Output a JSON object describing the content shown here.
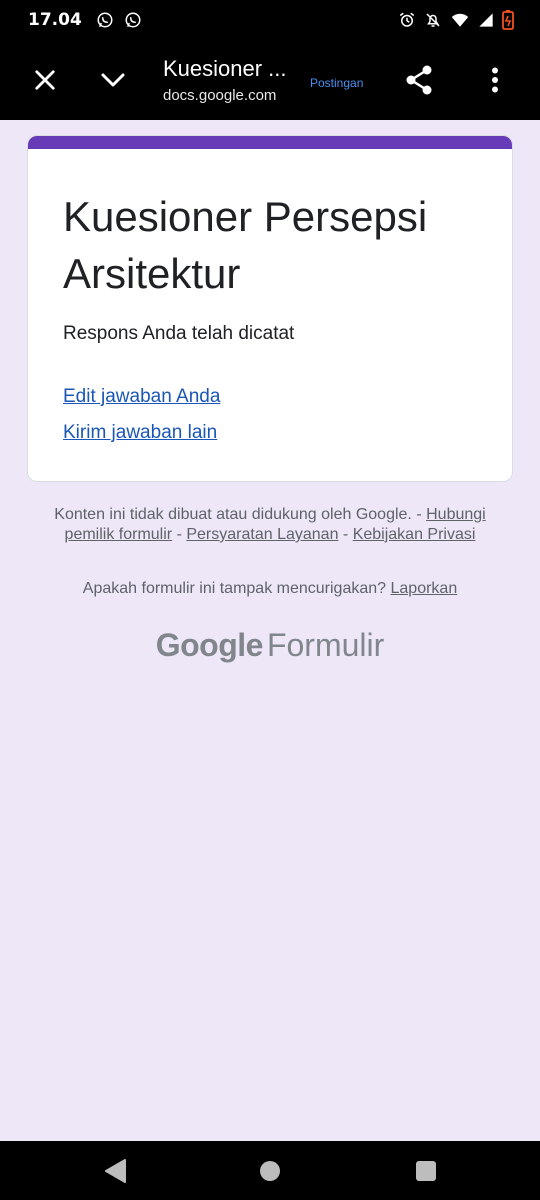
{
  "status_bar": {
    "time": "17.04",
    "icons": [
      "whatsapp-icon",
      "whatsapp-icon",
      "alarm-icon",
      "notifications-off-icon",
      "wifi-icon",
      "signal-icon",
      "battery-icon"
    ]
  },
  "toolbar": {
    "title": "Kuesioner ...",
    "url": "docs.google.com",
    "badge": "Postingan",
    "icons": [
      "close-icon",
      "chevron-down-icon",
      "share-icon",
      "more-vert-icon"
    ]
  },
  "form": {
    "accent_color": "#673ab7",
    "title": "Kuesioner Persepsi Arsitektur",
    "confirmation": "Respons Anda telah dicatat",
    "edit_link": "Edit jawaban Anda",
    "another_link": "Kirim jawaban lain"
  },
  "footer": {
    "disclaimer_text": "Konten ini tidak dibuat atau didukung oleh Google.",
    "separator": "-",
    "contact_link": "Hubungi pemilik formulir",
    "terms_link": "Persyaratan Layanan",
    "privacy_link": "Kebijakan Privasi",
    "report_question": "Apakah formulir ini tampak mencurigakan?",
    "report_link": "Laporkan",
    "brand_google": "Google",
    "brand_product": "Formulir"
  },
  "colors": {
    "page_background": "#ede7f8",
    "link": "#1a56b8",
    "muted_text": "#5f6368"
  }
}
